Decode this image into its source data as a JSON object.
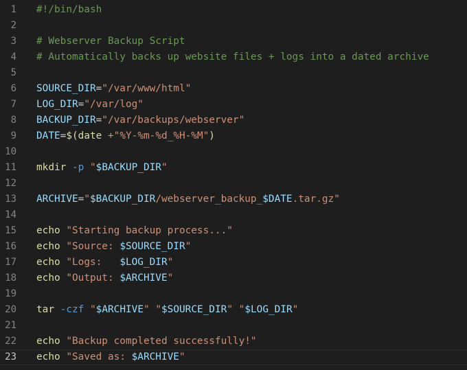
{
  "editor": {
    "colors": {
      "background": "#1e1e1e",
      "line_number": "#858585",
      "comment": "#6a9955",
      "variable": "#9cdcfe",
      "string": "#ce9178",
      "command": "#dcdcaa",
      "flag": "#569cd6",
      "plain": "#d4d4d4"
    },
    "current_line": 23,
    "lines": [
      {
        "num": "1",
        "tokens": [
          {
            "t": "#!/bin/bash",
            "c": "comment"
          }
        ]
      },
      {
        "num": "2",
        "tokens": []
      },
      {
        "num": "3",
        "tokens": [
          {
            "t": "# Webserver Backup Script",
            "c": "comment"
          }
        ]
      },
      {
        "num": "4",
        "tokens": [
          {
            "t": "# Automatically backs up website files + logs into a dated archive",
            "c": "comment"
          }
        ]
      },
      {
        "num": "5",
        "tokens": []
      },
      {
        "num": "6",
        "tokens": [
          {
            "t": "SOURCE_DIR",
            "c": "var"
          },
          {
            "t": "=",
            "c": "op"
          },
          {
            "t": "\"/var/www/html\"",
            "c": "str"
          }
        ]
      },
      {
        "num": "7",
        "tokens": [
          {
            "t": "LOG_DIR",
            "c": "var"
          },
          {
            "t": "=",
            "c": "op"
          },
          {
            "t": "\"/var/log\"",
            "c": "str"
          }
        ]
      },
      {
        "num": "8",
        "tokens": [
          {
            "t": "BACKUP_DIR",
            "c": "var"
          },
          {
            "t": "=",
            "c": "op"
          },
          {
            "t": "\"/var/backups/webserver\"",
            "c": "str"
          }
        ]
      },
      {
        "num": "9",
        "tokens": [
          {
            "t": "DATE",
            "c": "var"
          },
          {
            "t": "=",
            "c": "op"
          },
          {
            "t": "$",
            "c": "kw"
          },
          {
            "t": "(",
            "c": "kw"
          },
          {
            "t": "date ",
            "c": "cmd"
          },
          {
            "t": "+",
            "c": "str"
          },
          {
            "t": "\"%Y-%m-%d_%H-%M\"",
            "c": "str"
          },
          {
            "t": ")",
            "c": "kw"
          }
        ]
      },
      {
        "num": "10",
        "tokens": []
      },
      {
        "num": "11",
        "tokens": [
          {
            "t": "mkdir",
            "c": "cmd"
          },
          {
            "t": " ",
            "c": "plain"
          },
          {
            "t": "-p",
            "c": "flag"
          },
          {
            "t": " ",
            "c": "plain"
          },
          {
            "t": "\"",
            "c": "str"
          },
          {
            "t": "$BACKUP_DIR",
            "c": "var"
          },
          {
            "t": "\"",
            "c": "str"
          }
        ]
      },
      {
        "num": "12",
        "tokens": []
      },
      {
        "num": "13",
        "tokens": [
          {
            "t": "ARCHIVE",
            "c": "var"
          },
          {
            "t": "=",
            "c": "op"
          },
          {
            "t": "\"",
            "c": "str"
          },
          {
            "t": "$BACKUP_DIR",
            "c": "var"
          },
          {
            "t": "/webserver_backup_",
            "c": "str"
          },
          {
            "t": "$DATE",
            "c": "var"
          },
          {
            "t": ".tar.gz\"",
            "c": "str"
          }
        ]
      },
      {
        "num": "14",
        "tokens": []
      },
      {
        "num": "15",
        "tokens": [
          {
            "t": "echo",
            "c": "cmd"
          },
          {
            "t": " ",
            "c": "plain"
          },
          {
            "t": "\"Starting backup process...\"",
            "c": "str"
          }
        ]
      },
      {
        "num": "16",
        "tokens": [
          {
            "t": "echo",
            "c": "cmd"
          },
          {
            "t": " ",
            "c": "plain"
          },
          {
            "t": "\"Source: ",
            "c": "str"
          },
          {
            "t": "$SOURCE_DIR",
            "c": "var"
          },
          {
            "t": "\"",
            "c": "str"
          }
        ]
      },
      {
        "num": "17",
        "tokens": [
          {
            "t": "echo",
            "c": "cmd"
          },
          {
            "t": " ",
            "c": "plain"
          },
          {
            "t": "\"Logs:   ",
            "c": "str"
          },
          {
            "t": "$LOG_DIR",
            "c": "var"
          },
          {
            "t": "\"",
            "c": "str"
          }
        ]
      },
      {
        "num": "18",
        "tokens": [
          {
            "t": "echo",
            "c": "cmd"
          },
          {
            "t": " ",
            "c": "plain"
          },
          {
            "t": "\"Output: ",
            "c": "str"
          },
          {
            "t": "$ARCHIVE",
            "c": "var"
          },
          {
            "t": "\"",
            "c": "str"
          }
        ]
      },
      {
        "num": "19",
        "tokens": []
      },
      {
        "num": "20",
        "tokens": [
          {
            "t": "tar",
            "c": "cmd"
          },
          {
            "t": " ",
            "c": "plain"
          },
          {
            "t": "-czf",
            "c": "flag"
          },
          {
            "t": " ",
            "c": "plain"
          },
          {
            "t": "\"",
            "c": "str"
          },
          {
            "t": "$ARCHIVE",
            "c": "var"
          },
          {
            "t": "\"",
            "c": "str"
          },
          {
            "t": " ",
            "c": "plain"
          },
          {
            "t": "\"",
            "c": "str"
          },
          {
            "t": "$SOURCE_DIR",
            "c": "var"
          },
          {
            "t": "\"",
            "c": "str"
          },
          {
            "t": " ",
            "c": "plain"
          },
          {
            "t": "\"",
            "c": "str"
          },
          {
            "t": "$LOG_DIR",
            "c": "var"
          },
          {
            "t": "\"",
            "c": "str"
          }
        ]
      },
      {
        "num": "21",
        "tokens": []
      },
      {
        "num": "22",
        "tokens": [
          {
            "t": "echo",
            "c": "cmd"
          },
          {
            "t": " ",
            "c": "plain"
          },
          {
            "t": "\"Backup completed successfully!\"",
            "c": "str"
          }
        ]
      },
      {
        "num": "23",
        "tokens": [
          {
            "t": "echo",
            "c": "cmd"
          },
          {
            "t": " ",
            "c": "plain"
          },
          {
            "t": "\"Saved as: ",
            "c": "str"
          },
          {
            "t": "$ARCHIVE",
            "c": "var"
          },
          {
            "t": "\"",
            "c": "str"
          }
        ]
      }
    ]
  }
}
